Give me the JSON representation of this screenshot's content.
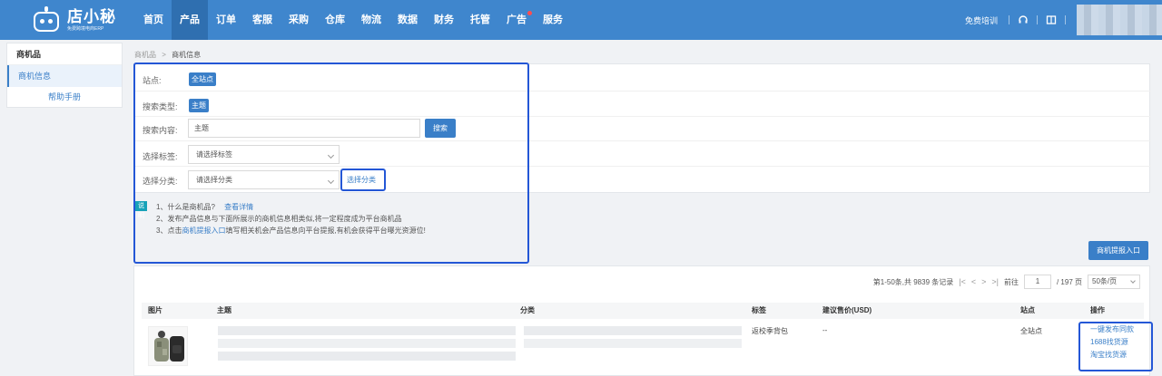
{
  "brand": {
    "name": "店小秘",
    "subtitle": "免费跨境电商ERP"
  },
  "nav": {
    "items": [
      "首页",
      "产品",
      "订单",
      "客服",
      "采购",
      "仓库",
      "物流",
      "数据",
      "财务",
      "托管",
      "广告",
      "服务"
    ],
    "active_index": 1,
    "badge_index": 10,
    "right_link": "免费培训"
  },
  "sidebar": {
    "header": "商机品",
    "item": "商机信息",
    "help": "帮助手册"
  },
  "breadcrumb": {
    "root": "商机品",
    "sep": ">",
    "current": "商机信息"
  },
  "filter": {
    "site_label": "站点:",
    "site_value": "全站点",
    "search_type_label": "搜索类型:",
    "search_type_value": "主题",
    "search_content_label": "搜索内容:",
    "search_input_value": "主题",
    "search_button": "搜索",
    "tag_label": "选择标签:",
    "tag_placeholder": "请选择标签",
    "category_label": "选择分类:",
    "category_placeholder": "请选择分类",
    "choose_category": "选择分类"
  },
  "notes": {
    "tag": "说明",
    "line1": "1、什么是商机品?",
    "line1_link": "查看详情",
    "line2": "2、发布产品信息与下面所展示的商机信息相类似,将一定程度成为平台商机品",
    "line3_prefix": "3、点击",
    "line3_link": "商机提报入口",
    "line3_suffix": "填写相关机会产品信息向平台提报,有机会获得平台曝光资源位!"
  },
  "entry_button": "商机提报入口",
  "pager": {
    "summary": "第1-50条,共 9839 条记录",
    "goto_label": "前往",
    "page_value": "1",
    "total_pages": "/ 197 页",
    "page_size": "50条/页"
  },
  "table": {
    "headers": {
      "image": "图片",
      "title": "主题",
      "category": "分类",
      "tag": "标签",
      "price": "建议售价(USD)",
      "site": "站点",
      "ops": "操作"
    },
    "rows": [
      {
        "tag": "返校季背包",
        "price": "--",
        "site": "全站点",
        "ops": [
          "一键发布同款",
          "1688找货源",
          "淘宝找货源"
        ]
      }
    ]
  },
  "colors": {
    "nav_bg": "#3f86cd",
    "accent": "#3a7fc8",
    "highlight_box": "#2457d6",
    "note_tag": "#17a2b8"
  },
  "icons": [
    "headset-icon",
    "book-icon"
  ]
}
